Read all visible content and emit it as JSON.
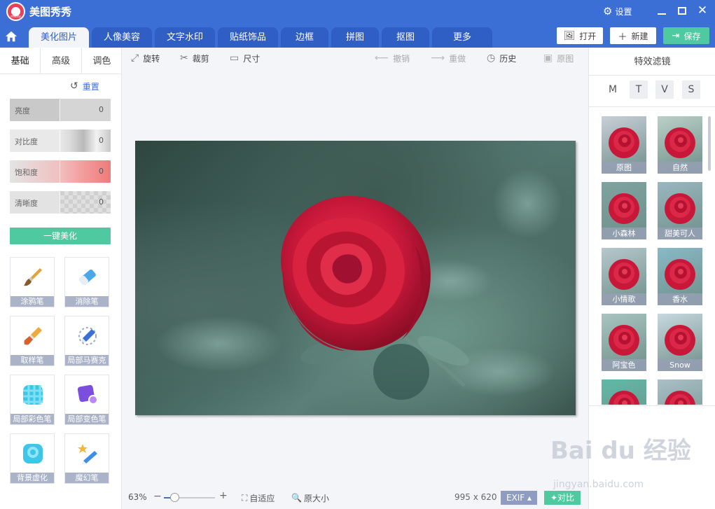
{
  "app": {
    "title": "美图秀秀",
    "logo_text": "meitu",
    "settings_label": "设置"
  },
  "tabs": [
    {
      "label": "美化图片",
      "active": true
    },
    {
      "label": "人像美容",
      "active": false
    },
    {
      "label": "文字水印",
      "active": false
    },
    {
      "label": "贴纸饰品",
      "active": false
    },
    {
      "label": "边框",
      "active": false
    },
    {
      "label": "拼图",
      "active": false
    },
    {
      "label": "抠图",
      "active": false
    },
    {
      "label": "更多",
      "active": false
    }
  ],
  "file_buttons": {
    "open": "打开",
    "new": "新建",
    "save": "保存"
  },
  "left_panel": {
    "subtabs": [
      "基础",
      "高级",
      "调色"
    ],
    "active_subtab": "基础",
    "reset_label": "重置",
    "sliders": [
      {
        "label": "亮度",
        "value": "0"
      },
      {
        "label": "对比度",
        "value": "0"
      },
      {
        "label": "饱和度",
        "value": "0"
      },
      {
        "label": "清晰度",
        "value": "0"
      }
    ],
    "one_click_label": "一键美化",
    "tools": [
      {
        "label": "涂鸦笔",
        "icon": "brush-icon"
      },
      {
        "label": "消除笔",
        "icon": "eraser-icon"
      },
      {
        "label": "取样笔",
        "icon": "sampler-brush-icon"
      },
      {
        "label": "局部马赛克",
        "icon": "mosaic-pen-icon"
      },
      {
        "label": "局部彩色笔",
        "icon": "color-pen-icon"
      },
      {
        "label": "局部变色笔",
        "icon": "recolor-pen-icon"
      },
      {
        "label": "背景虚化",
        "icon": "blur-icon"
      },
      {
        "label": "魔幻笔",
        "icon": "magic-pen-icon"
      }
    ]
  },
  "toolbar": {
    "rotate": "旋转",
    "crop": "裁剪",
    "size": "尺寸",
    "undo": "撤销",
    "redo": "重做",
    "history": "历史",
    "original": "原图"
  },
  "status": {
    "zoom": "63%",
    "zoom_fraction": 0.2,
    "fit": "自适应",
    "actual_size": "原大小",
    "dimensions": "995 x 620",
    "exif": "EXIF",
    "compare": "对比"
  },
  "right_panel": {
    "title": "特效滤镜",
    "categories": [
      "M",
      "T",
      "V",
      "S"
    ],
    "filters": [
      {
        "label": "原图",
        "tint": "#c8cfd8"
      },
      {
        "label": "自然",
        "tint": "#b9d0c8"
      },
      {
        "label": "小森林",
        "tint": "#7fa3a0"
      },
      {
        "label": "甜美可人",
        "tint": "#9ab7c0"
      },
      {
        "label": "小情歌",
        "tint": "#b5c8cc"
      },
      {
        "label": "香水",
        "tint": "#89b9c6"
      },
      {
        "label": "阿宝色",
        "tint": "#a9c4c0"
      },
      {
        "label": "Snow",
        "tint": "#c8d8df"
      },
      {
        "label": "",
        "tint": "#5fb9a7"
      },
      {
        "label": "",
        "tint": "#a9c0c8"
      }
    ]
  },
  "watermark": {
    "brand": "Bai du 经验",
    "site": "jingyan.baidu.com"
  },
  "colors": {
    "brand_blue": "#3c6fd6",
    "accent_green": "#4ec9a0",
    "rose": "#d01c3c"
  }
}
